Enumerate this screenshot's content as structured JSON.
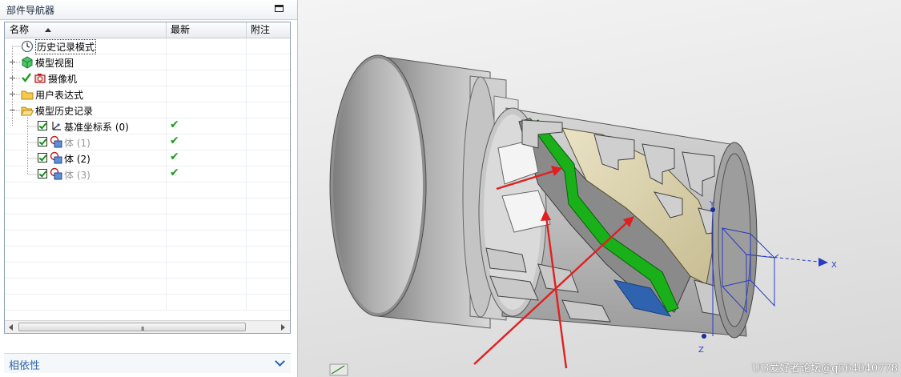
{
  "navigator": {
    "title": "部件导航器",
    "columns": {
      "name": "名称",
      "latest": "最新",
      "comment": "附注"
    },
    "rows": [
      {
        "label": "历史记录模式",
        "icon": "clock-icon",
        "latest": ""
      },
      {
        "label": "模型视图",
        "icon": "model-views-icon",
        "latest": ""
      },
      {
        "label": "摄像机",
        "icon": "camera-icon",
        "latest": ""
      },
      {
        "label": "用户表达式",
        "icon": "folder-icon",
        "latest": ""
      },
      {
        "label": "模型历史记录",
        "icon": "open-folder-icon",
        "latest": ""
      },
      {
        "label": "基准坐标系 (0)",
        "icon": "datum-csys-icon",
        "latest": "✔"
      },
      {
        "label": "体 (1)",
        "icon": "body-feature-icon",
        "latest": "✔"
      },
      {
        "label": "体 (2)",
        "icon": "body-feature-icon",
        "latest": "✔"
      },
      {
        "label": "体 (3)",
        "icon": "body-feature-icon",
        "latest": "✔"
      }
    ],
    "scroll_grip": "III",
    "dependencies_label": "相依性"
  },
  "viewport": {
    "axes": {
      "x": "X",
      "y": "Y",
      "z": "Z"
    },
    "watermark": "UG爱好者论坛@q564040778"
  },
  "colors": {
    "accent": "#2a63a4",
    "check_green": "#1d9a1d",
    "axis_blue": "#2a3cc4",
    "annotation_arrow": "#e02020",
    "highlight_face": "#19b019",
    "feature_face": "#d8cfaa"
  }
}
